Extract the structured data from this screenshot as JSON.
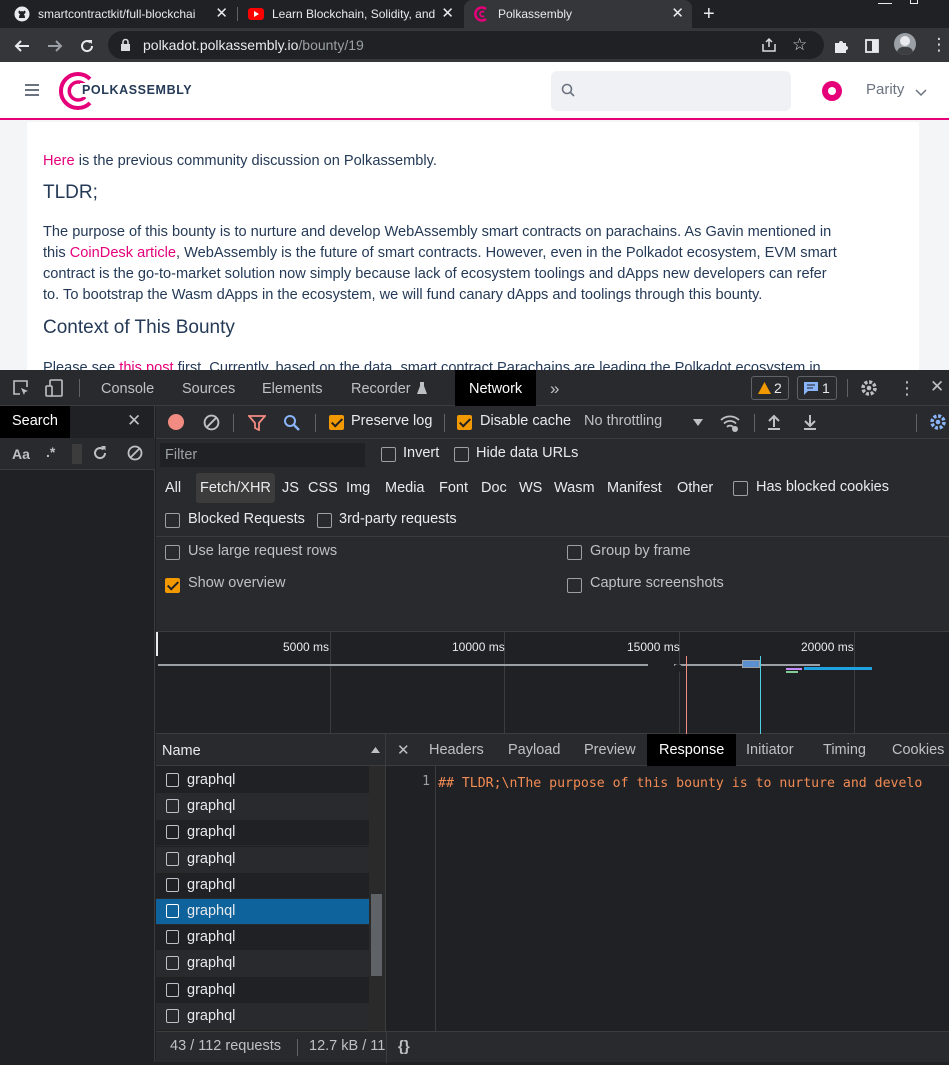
{
  "browser": {
    "tabs": [
      {
        "title": "smartcontractkit/full-blockchai"
      },
      {
        "title": "Learn Blockchain, Solidity, and"
      },
      {
        "title": "Polkassembly"
      }
    ],
    "new_tab_label": "+",
    "url_host": "polkadot.polkassembly.io",
    "url_path": "/bounty/19"
  },
  "site": {
    "logo_text": "POLKASSEMBLY",
    "network_label": "Parity",
    "content": {
      "p1_link": "Here",
      "p1_rest": " is the previous community discussion on Polkassembly.",
      "h_tldr": "TLDR;",
      "p2_a": "The purpose of this bounty is to nurture and develop WebAssembly smart contracts on parachains. As Gavin mentioned in",
      "p2_b_pre": "this ",
      "p2_b_link": "CoinDesk article",
      "p2_b_post": ", WebAssembly is the future of smart contracts. However, even in the Polkadot ecosystem, EVM smart",
      "p2_c": "contract is the go-to-market solution now simply because lack of ecosystem toolings and dApps new developers can refer",
      "p2_d": "to. To bootstrap the Wasm dApps in the ecosystem, we will fund canary dApps and toolings through this bounty.",
      "h_context": "Context of This Bounty",
      "p3_pre": "Please see ",
      "p3_link": "this post",
      "p3_post": " first. Currently, based on the data, smart contract Parachains are leading the Polkadot ecosystem in"
    }
  },
  "devtools": {
    "tabs": [
      "Console",
      "Sources",
      "Elements",
      "Recorder",
      "Network"
    ],
    "warnings_count": "2",
    "messages_count": "1",
    "search_label": "Search",
    "search_options": [
      "Aa",
      ".*"
    ],
    "toolbar": {
      "preserve_log": "Preserve log",
      "disable_cache": "Disable cache",
      "throttling": "No throttling"
    },
    "filter_placeholder": "Filter",
    "invert": "Invert",
    "hide_data_urls": "Hide data URLs",
    "type_filters": [
      "All",
      "Fetch/XHR",
      "JS",
      "CSS",
      "Img",
      "Media",
      "Font",
      "Doc",
      "WS",
      "Wasm",
      "Manifest",
      "Other"
    ],
    "has_blocked_cookies": "Has blocked cookies",
    "blocked_requests": "Blocked Requests",
    "third_party": "3rd-party requests",
    "use_large_rows": "Use large request rows",
    "show_overview": "Show overview",
    "group_by_frame": "Group by frame",
    "capture_screenshots": "Capture screenshots",
    "timeline_ticks": [
      "5000 ms",
      "10000 ms",
      "15000 ms",
      "20000 ms"
    ],
    "name_header": "Name",
    "requests": [
      "graphql",
      "graphql",
      "graphql",
      "graphql",
      "graphql",
      "graphql",
      "graphql",
      "graphql",
      "graphql",
      "graphql",
      "graphql"
    ],
    "selected_request_index": 5,
    "detail_tabs": [
      "Headers",
      "Payload",
      "Preview",
      "Response",
      "Initiator",
      "Timing",
      "Cookies"
    ],
    "response_line_number": "1",
    "response_text": "## TLDR;\\nThe purpose of this bounty is to nurture and develo",
    "status_requests": "43 / 112 requests",
    "status_transferred": "12.7 kB / 11",
    "pretty_print": "{}"
  }
}
